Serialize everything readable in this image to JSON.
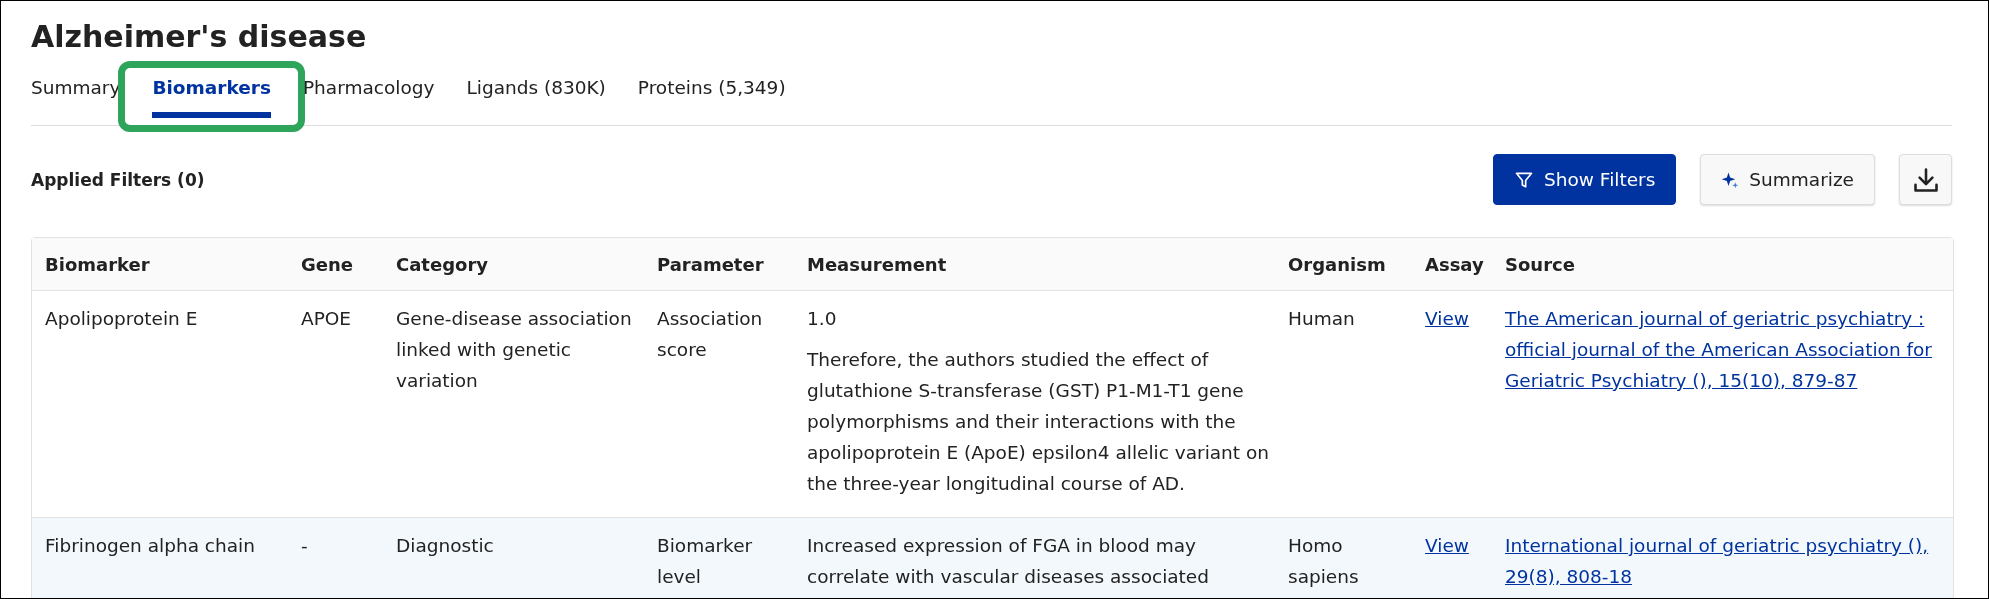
{
  "title": "Alzheimer's disease",
  "tabs": [
    {
      "label": "Summary",
      "selected": false,
      "highlighted": false
    },
    {
      "label": "Biomarkers",
      "selected": true,
      "highlighted": true
    },
    {
      "label": "Pharmacology",
      "selected": false,
      "highlighted": false
    },
    {
      "label": "Ligands (830K)",
      "selected": false,
      "highlighted": false
    },
    {
      "label": "Proteins (5,349)",
      "selected": false,
      "highlighted": false
    }
  ],
  "applied_filters": "Applied Filters (0)",
  "buttons": [
    {
      "kind": "primary",
      "label": "Show Filters"
    },
    {
      "kind": "secondary",
      "label": "Summarize"
    },
    {
      "kind": "download"
    }
  ],
  "table": {
    "columns": [
      "Biomarker",
      "Gene",
      "Category",
      "Parameter",
      "Measurement",
      "Organism",
      "Assay",
      "Source"
    ],
    "rows": [
      {
        "biomarker": "Apolipoprotein E",
        "gene": "APOE",
        "category": "Gene-disease association linked with genetic variation",
        "parameter": "Association score",
        "measurement": [
          "1.0",
          "Therefore, the authors studied the effect of glutathione S-transferase (GST) P1-M1-T1 gene polymorphisms and their interactions with the apolipoprotein E (ApoE) epsilon4 allelic variant on the three-year longitudinal course of AD."
        ],
        "organism": "Human",
        "assay": "View",
        "source": "The American journal of geriatric psychiatry : official journal of the American Association for Geriatric Psychiatry (), 15(10), 879-87"
      },
      {
        "biomarker": "Fibrinogen alpha chain",
        "gene": "-",
        "category": "Diagnostic",
        "parameter": "Biomarker level",
        "measurement": [
          "Increased expression of FGA in blood may correlate with vascular diseases associated"
        ],
        "organism": "Homo sapiens",
        "assay": "View",
        "source": "International journal of geriatric psychiatry (), 29(8), 808-18"
      }
    ]
  }
}
